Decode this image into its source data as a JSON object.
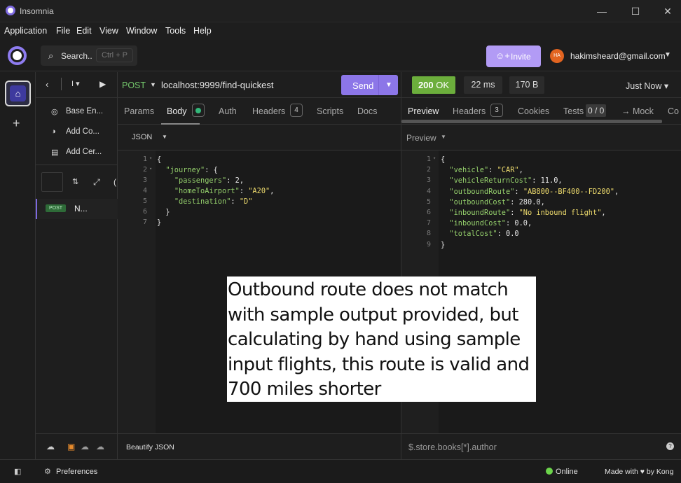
{
  "window": {
    "title": "Insomnia",
    "controls": {
      "minimize": "—",
      "maximize": "☐",
      "close": "✕"
    }
  },
  "menu": [
    "Application",
    "File",
    "Edit",
    "View",
    "Window",
    "Tools",
    "Help"
  ],
  "header": {
    "search_label": "Search..",
    "search_shortcut": "Ctrl + P",
    "invite_label": "Invite",
    "avatar_initials": "HA",
    "user_email": "hakimsheard@gmail.com"
  },
  "sidebar": {
    "items": [
      {
        "label": "Base En...",
        "icon": "globe-icon"
      },
      {
        "label": "Add Co...",
        "icon": "cookie-icon"
      },
      {
        "label": "Add Cer...",
        "icon": "certificate-icon"
      }
    ],
    "request": {
      "method": "POST",
      "label": "N..."
    }
  },
  "request": {
    "method": "POST",
    "url": "localhost:9999/find-quickest",
    "send_label": "Send",
    "tabs": {
      "params": "Params",
      "body": "Body",
      "auth": "Auth",
      "headers": "Headers",
      "headers_count": "4",
      "scripts": "Scripts",
      "docs": "Docs"
    },
    "body_type": "JSON",
    "footer": "Beautify JSON"
  },
  "response": {
    "status_code": "200",
    "status_text": "OK",
    "time": "22 ms",
    "size": "170 B",
    "when": "Just Now",
    "tabs": {
      "preview": "Preview",
      "headers": "Headers",
      "headers_count": "3",
      "cookies": "Cookies",
      "tests": "Tests",
      "tests_count": "0 / 0",
      "mock": "→ Mock",
      "console": "Co"
    },
    "view_mode": "Preview",
    "filter_placeholder": "$.store.books[*].author"
  },
  "status_bar": {
    "preferences": "Preferences",
    "online": "Online",
    "made_with": "Made with ♥ by Kong"
  },
  "annotation": {
    "lines": [
      "Outbound route  does not match",
      "with sample output provided, but",
      "calculating by hand using sample",
      "input flights, this route is valid and",
      "700 miles shorter"
    ]
  },
  "colors": {
    "accent": "#8c76e8",
    "ok": "#6cae3c",
    "json_key": "#95d06c",
    "json_string": "#f0dd6e"
  }
}
